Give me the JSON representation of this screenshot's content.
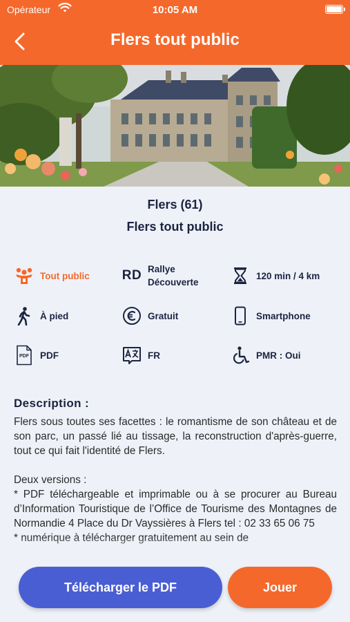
{
  "status": {
    "carrier": "Opérateur",
    "time": "10:05 AM"
  },
  "header": {
    "title": "Flers tout public"
  },
  "place": {
    "city": "Flers (61)",
    "subtitle": "Flers tout public"
  },
  "features": [
    {
      "icon": "audience-icon",
      "label": "Tout public",
      "highlight": true
    },
    {
      "icon": "rd-badge",
      "badge": "RD",
      "label": "Rallye\nDécouverte"
    },
    {
      "icon": "hourglass-icon",
      "label": "120 min / 4 km"
    },
    {
      "icon": "walking-icon",
      "label": "À pied"
    },
    {
      "icon": "euro-icon",
      "label": "Gratuit"
    },
    {
      "icon": "smartphone-icon",
      "label": "Smartphone"
    },
    {
      "icon": "pdf-icon",
      "label": "PDF"
    },
    {
      "icon": "translate-icon",
      "label": "FR"
    },
    {
      "icon": "wheelchair-icon",
      "label": "PMR : Oui"
    }
  ],
  "description": {
    "heading": "Description :",
    "text": "Flers sous toutes ses facettes : le romantisme de son château et de son parc, un passé lié au tissage, la reconstruction d'après-guerre, tout ce qui fait l'identité de Flers.\n\nDeux versions :\n* PDF téléchargeable et imprimable ou à se procurer au Bureau d’Information Touristique de l’Office de Tourisme des Montagnes de Normandie 4 Place du Dr Vayssières à Flers tel : 02 33 65 06 75\n* numérique à télécharger gratuitement au sein de"
  },
  "buttons": {
    "download_pdf": "Télécharger le PDF",
    "play": "Jouer"
  },
  "colors": {
    "accent": "#f5682b",
    "primary_button": "#4a5ed3",
    "text": "#1c2340",
    "background": "#eef2f8"
  }
}
